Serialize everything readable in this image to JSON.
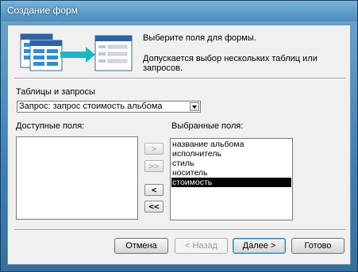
{
  "window": {
    "title": "Создание форм"
  },
  "intro": {
    "line1": "Выберите поля для формы.",
    "line2": "Допускается выбор нескольких таблиц или запросов."
  },
  "source": {
    "label": "Таблицы и запросы",
    "selected": "Запрос: запрос стоимость альбома"
  },
  "available": {
    "label": "Доступные поля:",
    "items": []
  },
  "selected_fields": {
    "label": "Выбранные поля:",
    "items": [
      "название альбома",
      "исполнитель",
      "стиль",
      "носитель",
      "стоимость"
    ],
    "highlighted": "стоимость"
  },
  "move_buttons": {
    "add": ">",
    "add_all": ">>",
    "remove": "<",
    "remove_all": "<<"
  },
  "footer": {
    "cancel": "Отмена",
    "back": "< Назад",
    "next": "Далее >",
    "finish": "Готово"
  },
  "colors": {
    "selection": "#000000",
    "title_bar": "#4c8bbd"
  }
}
